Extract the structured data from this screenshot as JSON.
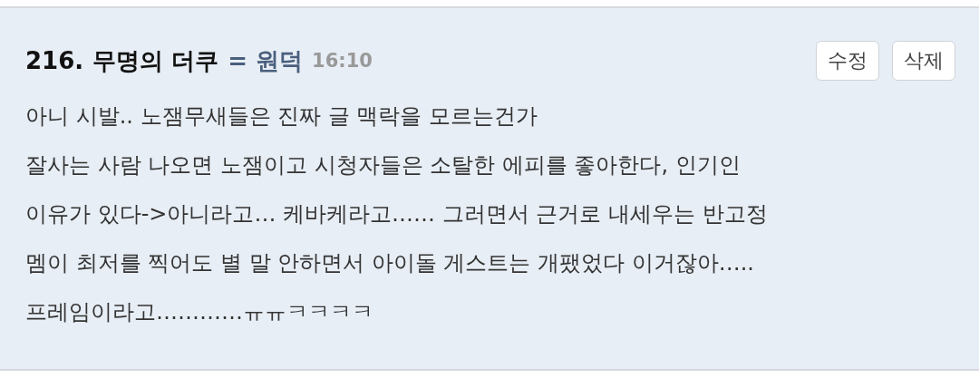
{
  "comment": {
    "number": "216.",
    "author": "무명의 더쿠",
    "tag": "= 원덕",
    "time": "16:10",
    "buttons": [
      "수정",
      "삭제"
    ],
    "body": "아니 시발.. 노잼무새들은 진짜 글 맥락을 모르는건가\n잘사는 사람 나오면 노잼이고 시청자들은 소탈한 에피를 좋아한다, 인기인\n이유가 있다->아니라고… 케바케라고…… 그러면서 근거로 내세우는 반고정\n멤이 최저를 찍어도 별 말 안하면서 아이돌 게스트는 개팼었다 이거잖아…..\n프레임이라고…………ㅠㅠㅋㅋㅋㅋ"
  }
}
